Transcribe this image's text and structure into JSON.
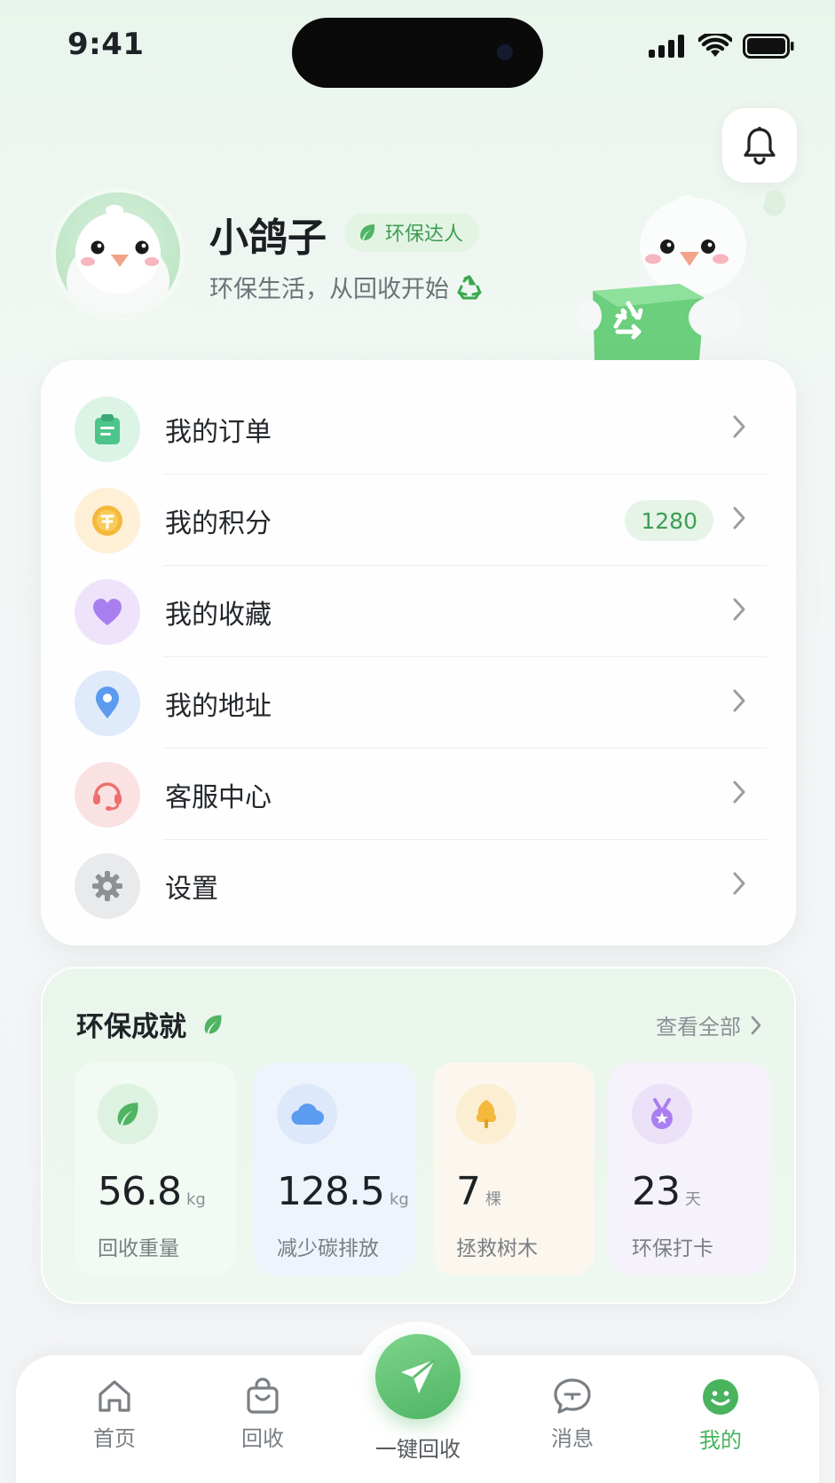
{
  "status_bar": {
    "time": "9:41"
  },
  "profile": {
    "name": "小鸽子",
    "badge": "环保达人",
    "motto": "环保生活，从回收开始"
  },
  "menu": [
    {
      "label": "我的订单",
      "icon": "clipboard-icon",
      "color": "#4cc48a"
    },
    {
      "label": "我的积分",
      "icon": "coin-icon",
      "color": "#f4b83c",
      "value": "1280"
    },
    {
      "label": "我的收藏",
      "icon": "heart-icon",
      "color": "#a97ff0"
    },
    {
      "label": "我的地址",
      "icon": "location-pin-icon",
      "color": "#5b9bf0"
    },
    {
      "label": "客服中心",
      "icon": "headset-icon",
      "color": "#ef6f6f"
    },
    {
      "label": "设置",
      "icon": "gear-icon",
      "color": "#8d9196"
    }
  ],
  "achievements": {
    "title": "环保成就",
    "more": "查看全部",
    "stats": [
      {
        "value": "56.8",
        "unit": "kg",
        "label": "回收重量",
        "icon": "leaf-icon"
      },
      {
        "value": "128.5",
        "unit": "kg",
        "label": "减少碳排放",
        "icon": "cloud-icon"
      },
      {
        "value": "7",
        "unit": "棵",
        "label": "拯救树木",
        "icon": "tree-icon"
      },
      {
        "value": "23",
        "unit": "天",
        "label": "环保打卡",
        "icon": "medal-icon"
      }
    ]
  },
  "nav": {
    "home": "首页",
    "recycle": "回收",
    "quick_recycle": "一键回收",
    "messages": "消息",
    "mine": "我的"
  },
  "colors": {
    "accent": "#4fb463",
    "accent_light": "#e3f4e5"
  }
}
